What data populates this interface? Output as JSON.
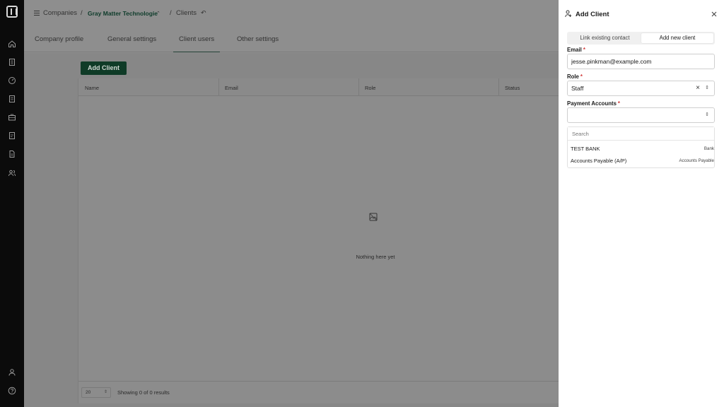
{
  "breadcrumb": {
    "companies": "Companies",
    "sep1": "/",
    "company": "Gray Matter Technologie",
    "sep2": "/",
    "current": "Clients"
  },
  "tabs": [
    {
      "label": "Company profile",
      "active": false
    },
    {
      "label": "General settings",
      "active": false
    },
    {
      "label": "Client users",
      "active": true
    },
    {
      "label": "Other settings",
      "active": false
    }
  ],
  "toolbar": {
    "add_client_label": "Add Client"
  },
  "table": {
    "columns": [
      "Name",
      "Email",
      "Role",
      "Status"
    ],
    "empty_text": "Nothing here yet",
    "page_size": "20",
    "showing_text": "Showing 0 of 0 results"
  },
  "panel": {
    "title": "Add Client",
    "segments": [
      {
        "label": "Link existing contact",
        "selected": false
      },
      {
        "label": "Add new client",
        "selected": true
      }
    ],
    "email_label": "Email",
    "email_value": "jesse.pinkman@example.com",
    "role_label": "Role",
    "role_value": "Staff",
    "payment_label": "Payment Accounts",
    "required_mark": "*",
    "search_placeholder": "Search",
    "accounts": [
      {
        "name": "TEST BANK",
        "type": "Bank"
      },
      {
        "name": "Accounts Payable (A/P)",
        "type": "Accounts Payable"
      }
    ]
  },
  "colors": {
    "brand_green": "#0f3b27",
    "overlay": "#8e8e8e",
    "rail": "#0b0b0b"
  }
}
